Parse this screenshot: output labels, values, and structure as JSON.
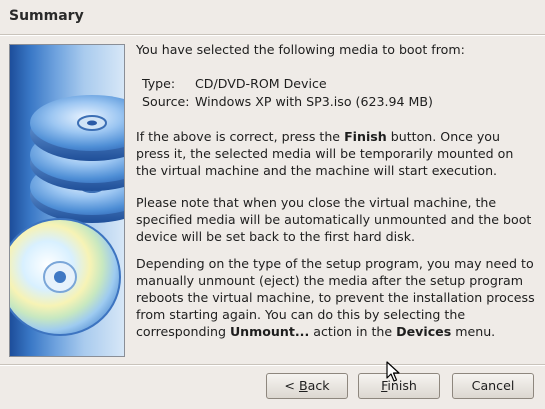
{
  "page": {
    "title": "Summary"
  },
  "summary": {
    "intro": "You have selected the following media to boot from:",
    "type_label": "Type:",
    "type_value": "CD/DVD-ROM Device",
    "source_label": "Source:",
    "source_value": "Windows XP with SP3.iso (623.94 MB)",
    "p1_a": "If the above is correct, press the ",
    "p1_bold": "Finish",
    "p1_b": " button. Once you press it, the selected media will be temporarily mounted on the virtual machine and the machine will start execution.",
    "p2": "Please note that when you close the virtual machine, the specified media will be automatically unmounted and the boot device will be set back to the first hard disk.",
    "p3_a": "Depending on the type of the setup program, you may need to manually unmount (eject) the media after the setup program reboots the virtual machine, to prevent the installation process from starting again. You can do this by selecting the corresponding ",
    "p3_bold1": "Unmount...",
    "p3_b": " action in the ",
    "p3_bold2": "Devices",
    "p3_c": " menu."
  },
  "buttons": {
    "back_prefix": "< ",
    "back_mnemonic": "B",
    "back_rest": "ack",
    "finish_mnemonic": "F",
    "finish_rest": "inish",
    "cancel": "Cancel"
  },
  "icons": {
    "banner": "cd-stack-icon",
    "cursor": "mouse-pointer-icon"
  }
}
